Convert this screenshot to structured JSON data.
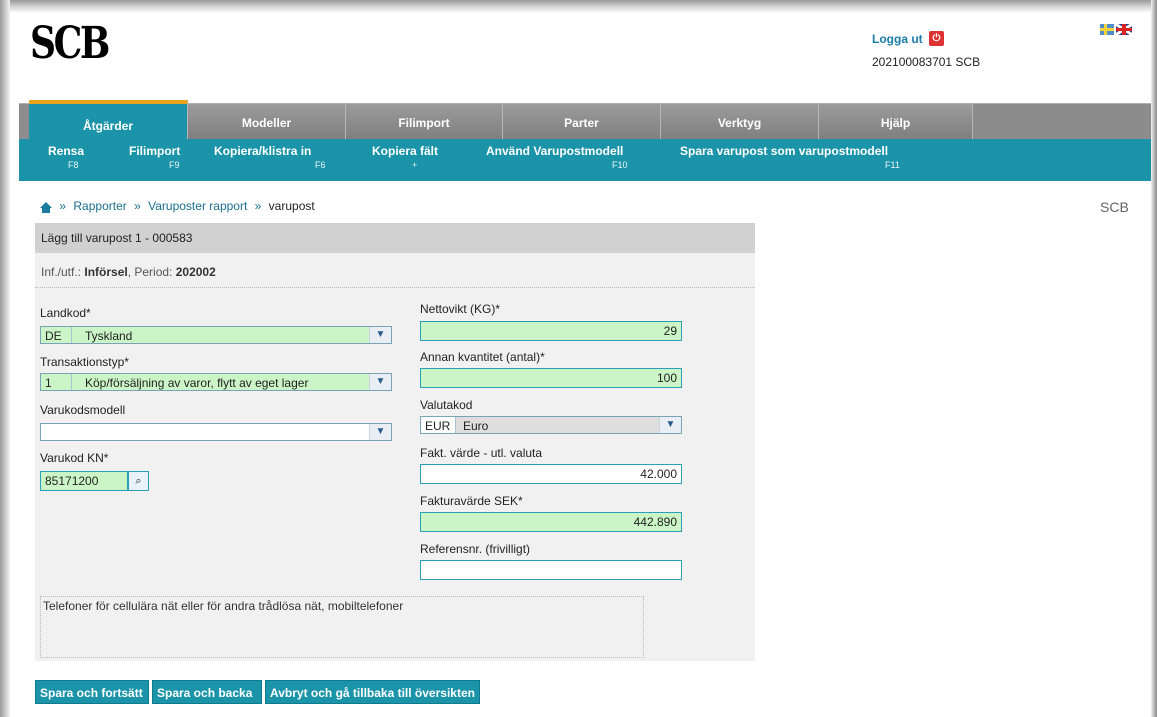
{
  "header": {
    "logo": "SCB",
    "logout_label": "Logga ut",
    "user_id": "202100083701 SCB"
  },
  "main_nav": [
    {
      "label": "Åtgärder",
      "active": true
    },
    {
      "label": "Modeller",
      "active": false
    },
    {
      "label": "Filimport",
      "active": false
    },
    {
      "label": "Parter",
      "active": false
    },
    {
      "label": "Verktyg",
      "active": false
    },
    {
      "label": "Hjälp",
      "active": false
    }
  ],
  "sub_nav": [
    {
      "label": "Rensa",
      "key": "F8"
    },
    {
      "label": "Filimport",
      "key": "F9"
    },
    {
      "label": "Kopiera/klistra in",
      "key": "F6"
    },
    {
      "label": "Kopiera fält",
      "key": "+"
    },
    {
      "label": "Använd Varupostmodell",
      "key": "F10"
    },
    {
      "label": "Spara varupost som varupostmodell",
      "key": "F11"
    }
  ],
  "breadcrumb": {
    "items": [
      "Rapporter",
      "Varuposter rapport"
    ],
    "current": "varupost",
    "right_label": "SCB"
  },
  "form": {
    "title": "Lägg till varupost 1 - 000583",
    "info_prefix": "Inf./utf.: ",
    "info_type": "Införsel",
    "info_period_label": ", Period: ",
    "info_period": "202002",
    "landkod": {
      "label": "Landkod*",
      "code": "DE",
      "name": "Tyskland"
    },
    "transaktionstyp": {
      "label": "Transaktionstyp*",
      "code": "1",
      "name": "Köp/försäljning av varor, flytt av eget lager"
    },
    "varukodsmodell": {
      "label": "Varukodsmodell",
      "value": ""
    },
    "varukod": {
      "label": "Varukod KN*",
      "value": "85171200"
    },
    "nettovikt": {
      "label": "Nettovikt (KG)*",
      "value": "29"
    },
    "annan_kvantitet": {
      "label": "Annan kvantitet (antal)*",
      "value": "100"
    },
    "valutakod": {
      "label": "Valutakod",
      "code": "EUR",
      "name": "Euro"
    },
    "fakt_varde": {
      "label": "Fakt. värde - utl. valuta",
      "value": "42.000"
    },
    "fakturavarde_sek": {
      "label": "Fakturavärde SEK*",
      "value": "442.890"
    },
    "referensnr": {
      "label": "Referensnr. (frivilligt)",
      "value": ""
    },
    "description": "Telefoner för cellulära nät eller för andra trådlösa nät, mobiltelefoner"
  },
  "buttons": {
    "save_continue": "Spara och fortsätt",
    "save_back": "Spara och backa",
    "cancel": "Avbryt och gå tillbaka till översikten"
  },
  "colors": {
    "accent": "#1b93a9",
    "tab_gray": "#8c8c8c",
    "active_tab_border": "#e9a21a",
    "required_field_bg": "#ccf5c7",
    "link": "#1b6f8e"
  },
  "icons": {
    "logout": "power-icon",
    "home": "home-icon",
    "search": "binoculars-icon",
    "dropdown": "chevron-down-icon",
    "language_sv": "swedish-flag-icon",
    "language_en": "uk-flag-icon"
  }
}
